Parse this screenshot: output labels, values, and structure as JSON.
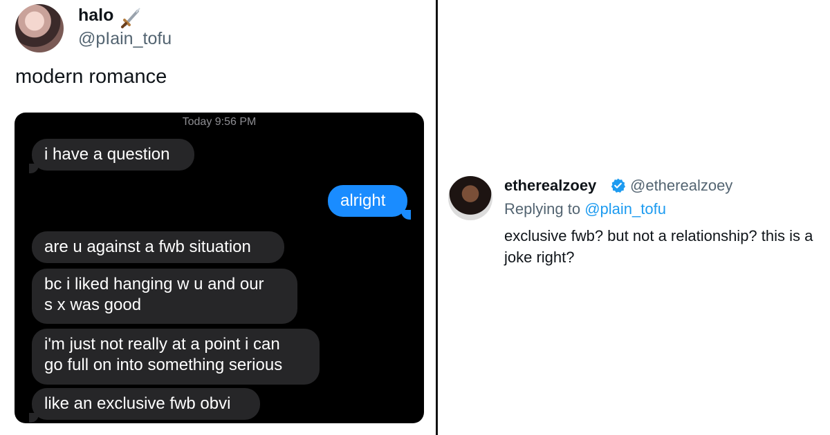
{
  "left_tweet": {
    "display_name": "halo",
    "handle": "@pIain_tofu",
    "text": "modern romance",
    "chat": {
      "timestamp": "Today 9:56 PM",
      "messages": [
        {
          "from": "them",
          "text": "i have a question"
        },
        {
          "from": "me",
          "text": "alright"
        },
        {
          "from": "them",
          "text": "are u against a fwb situation"
        },
        {
          "from": "them",
          "text": "bc i liked hanging w u and our\ns  x was good"
        },
        {
          "from": "them",
          "text": "i'm just not really at a point i can\ngo full on into something serious"
        },
        {
          "from": "them",
          "text": "like an exclusive fwb obvi"
        }
      ]
    }
  },
  "right_reply": {
    "display_name": "etherealzoey",
    "handle": "@etherealzoey",
    "replying_prefix": "Replying to",
    "replying_to": "@plain_tofu",
    "text": "exclusive fwb? but not a relationship? this is a joke right?"
  },
  "colors": {
    "outgoing_bubble": "#1a8cff",
    "incoming_bubble": "#262628",
    "mention_blue": "#1d9bf0",
    "verified_blue": "#1d9bf0"
  }
}
